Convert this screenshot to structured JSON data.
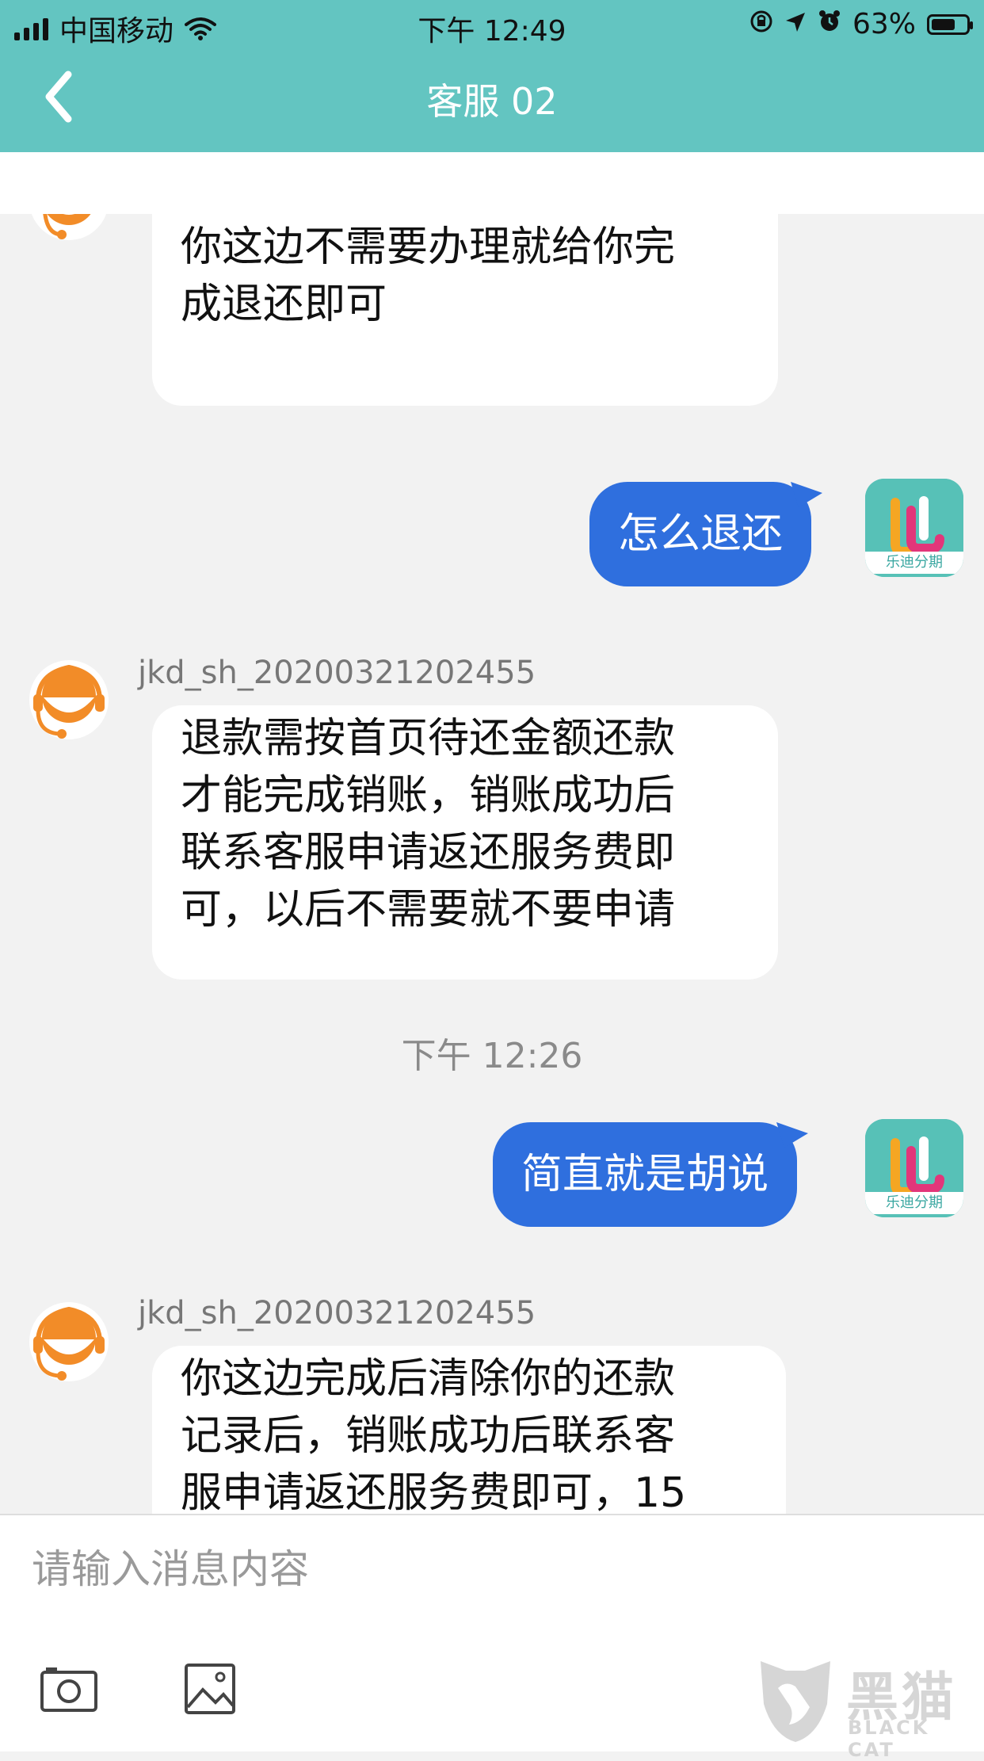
{
  "status_bar": {
    "carrier": "中国移动",
    "time": "下午 12:49",
    "battery": "63%",
    "battery_level": 0.63
  },
  "header": {
    "title": "客服 02"
  },
  "messages": [
    {
      "direction": "incoming",
      "sender": "",
      "text": "你这边不需要办理就给你完\n成退还即可"
    },
    {
      "direction": "outgoing",
      "text": "怎么退还"
    },
    {
      "direction": "incoming",
      "sender": "jkd_sh_20200321202455",
      "text": "退款需按首页待还金额还款\n才能完成销账，销账成功后\n联系客服申请返还服务费即\n可，以后不需要就不要申请"
    },
    {
      "type": "timestamp",
      "text": "下午 12:26"
    },
    {
      "direction": "outgoing",
      "text": "简直就是胡说"
    },
    {
      "direction": "incoming",
      "sender": "jkd_sh_20200321202455",
      "text": "你这边完成后清除你的还款\n记录后，销账成功后联系客\n服申请返还服务费即可，15"
    }
  ],
  "app_avatar": {
    "label": "乐迪分期"
  },
  "input": {
    "placeholder": "请输入消息内容",
    "value": ""
  },
  "toolbar": {
    "camera_icon": "camera-icon",
    "image_icon": "image-icon"
  },
  "watermark": {
    "text": "黑猫",
    "sub": "BLACK CAT"
  },
  "colors": {
    "header": "#63c5c1",
    "outgoing_bubble": "#2f6fde",
    "incoming_bubble": "#ffffff",
    "background": "#f2f2f2",
    "cs_avatar": "#f28c28"
  }
}
